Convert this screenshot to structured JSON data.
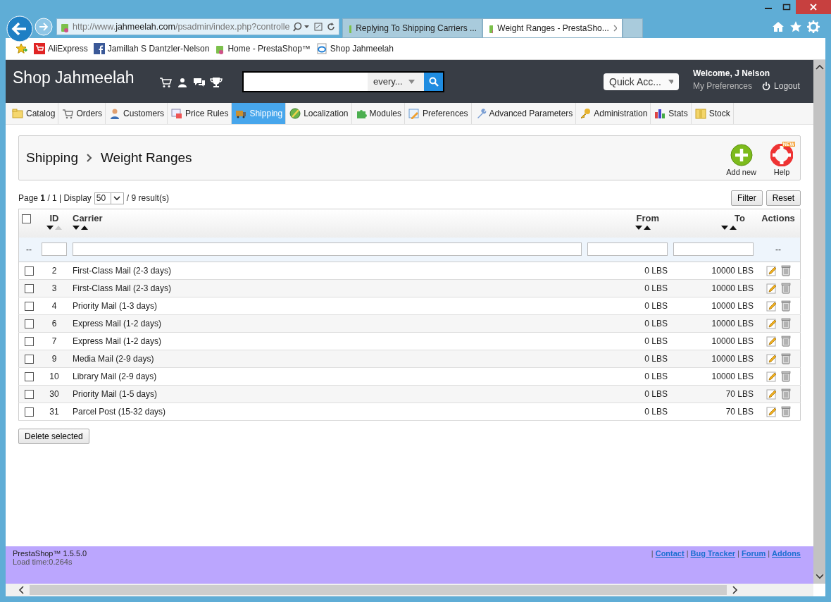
{
  "browser": {
    "address": {
      "prefix": "http://www.",
      "domain": "jahmeelah.com",
      "path": "/psadmin/index.php?controlle"
    },
    "tabs": [
      {
        "title": "Replying To Shipping Carriers ...",
        "selected": false
      },
      {
        "title": "Weight Ranges - PrestaSho...",
        "selected": true
      }
    ],
    "favorites": [
      "AliExpress",
      "Jamillah S Dantzler-Nelson",
      "Home - PrestaShop™",
      "Shop Jahmeelah"
    ]
  },
  "header": {
    "shop_name": "Shop Jahmeelah",
    "search": {
      "scope": "every..."
    },
    "quick_access": "Quick Acc...",
    "welcome": "Welcome, J Nelson",
    "my_preferences": "My Preferences",
    "logout": "Logout"
  },
  "menu": [
    {
      "label": "Catalog",
      "selected": false
    },
    {
      "label": "Orders",
      "selected": false
    },
    {
      "label": "Customers",
      "selected": false
    },
    {
      "label": "Price Rules",
      "selected": false
    },
    {
      "label": "Shipping",
      "selected": true
    },
    {
      "label": "Localization",
      "selected": false
    },
    {
      "label": "Modules",
      "selected": false
    },
    {
      "label": "Preferences",
      "selected": false
    },
    {
      "label": "Advanced Parameters",
      "selected": false
    },
    {
      "label": "Administration",
      "selected": false
    },
    {
      "label": "Stats",
      "selected": false
    },
    {
      "label": "Stock",
      "selected": false
    }
  ],
  "breadcrumb": [
    "Shipping",
    "Weight Ranges"
  ],
  "toolbar": {
    "add_new": "Add new",
    "help": "Help",
    "help_badge": "NEW"
  },
  "pagination": {
    "page": "Page **1** / 1 | Display",
    "per_page": "50",
    "results": "/ 9 result(s)"
  },
  "filter_button": "Filter",
  "reset_button": "Reset",
  "table": {
    "select_all_checked": false,
    "columns": [
      {
        "label": "ID",
        "up_dimmed": true
      },
      {
        "label": "Carrier",
        "up_dimmed": false
      },
      {
        "label": "From",
        "up_dimmed": false
      },
      {
        "label": "To",
        "up_dimmed": false
      }
    ],
    "actions_label": "Actions",
    "filter_dash": "--",
    "rows": [
      {
        "id": "2",
        "carrier": "First-Class Mail (2-3 days)",
        "from": "0 LBS",
        "to": "10000 LBS",
        "checked": false
      },
      {
        "id": "3",
        "carrier": "First-Class Mail (2-3 days)",
        "from": "0 LBS",
        "to": "10000 LBS",
        "checked": false
      },
      {
        "id": "4",
        "carrier": "Priority Mail (1-3 days)",
        "from": "0 LBS",
        "to": "10000 LBS",
        "checked": false
      },
      {
        "id": "6",
        "carrier": "Express Mail (1-2 days)",
        "from": "0 LBS",
        "to": "10000 LBS",
        "checked": false
      },
      {
        "id": "7",
        "carrier": "Express Mail (1-2 days)",
        "from": "0 LBS",
        "to": "10000 LBS",
        "checked": false
      },
      {
        "id": "9",
        "carrier": "Media Mail (2-9 days)",
        "from": "0 LBS",
        "to": "10000 LBS",
        "checked": false
      },
      {
        "id": "10",
        "carrier": "Library Mail (2-9 days)",
        "from": "0 LBS",
        "to": "10000 LBS",
        "checked": false
      },
      {
        "id": "30",
        "carrier": "Priority Mail (1-5 days)",
        "from": "0 LBS",
        "to": "70 LBS",
        "checked": false
      },
      {
        "id": "31",
        "carrier": "Parcel Post (15-32 days)",
        "from": "0 LBS",
        "to": "70 LBS",
        "checked": false
      }
    ]
  },
  "delete_selected": "Delete selected",
  "footer": {
    "version": "PrestaShop™ 1.5.5.0",
    "load_time": "Load time:0.264s",
    "separator": "|",
    "links": [
      "Contact",
      "Bug Tracker",
      "Forum",
      "Addons"
    ]
  }
}
